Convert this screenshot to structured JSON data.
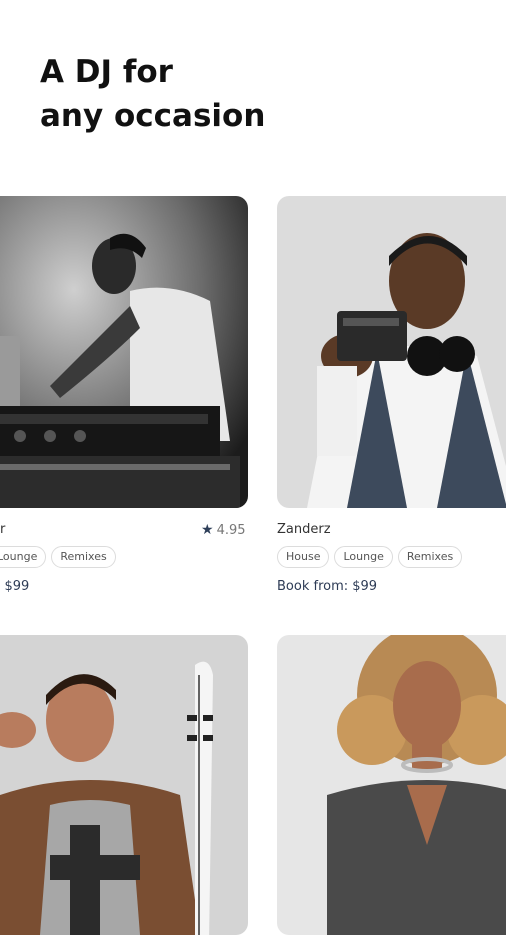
{
  "headline": {
    "line1": "A DJ for",
    "line2": "any occasion"
  },
  "cards": [
    {
      "name": "r",
      "rating": "4.95",
      "tags": [
        "Lounge",
        "Remixes"
      ],
      "price": ": $99",
      "photo_icon": "dj-at-mixer-photo"
    },
    {
      "name": "Zanderz",
      "tags": [
        "House",
        "Lounge",
        "Remixes"
      ],
      "price": "Book from: $99",
      "photo_icon": "dj-holding-controller-photo"
    },
    {
      "photo_icon": "violinist-saluting-photo"
    },
    {
      "photo_icon": "curly-hair-woman-photo"
    }
  ],
  "colors": {
    "accent": "#2e3f59",
    "tag_border": "#dcdcdc",
    "price": "#2d3b55"
  }
}
